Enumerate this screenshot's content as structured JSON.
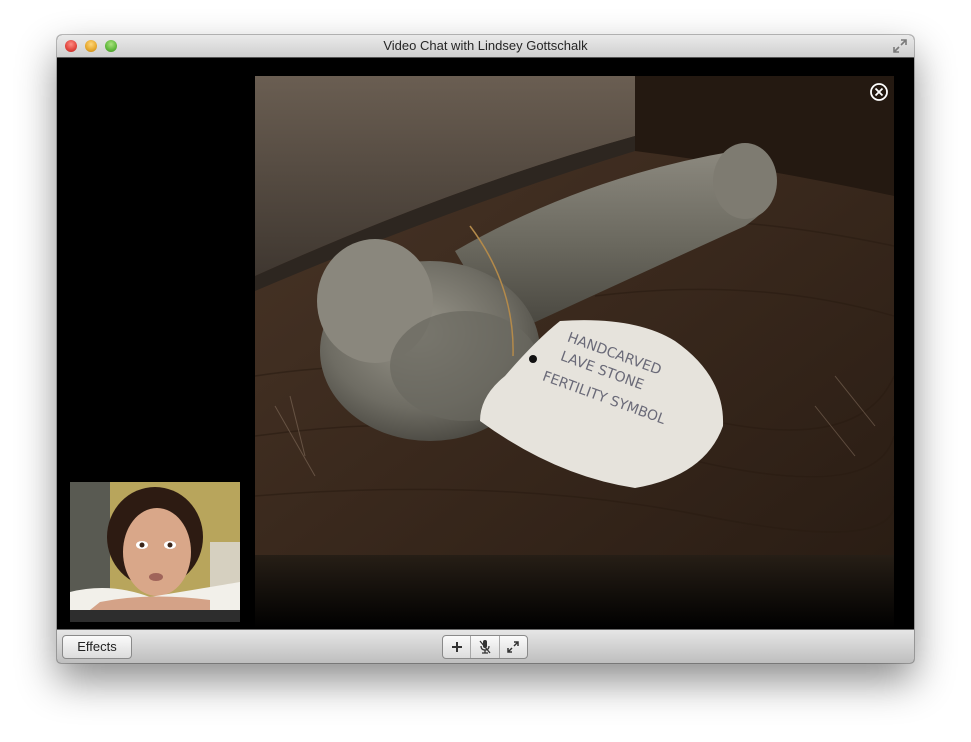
{
  "window": {
    "title": "Video Chat with Lindsey Gottschalk"
  },
  "remote_video": {
    "note_lines": [
      "HANDCARVED",
      "LAVE STONE",
      "FERTILITY SYMBOL"
    ]
  },
  "toolbar": {
    "effects_label": "Effects"
  },
  "icons": {
    "close": "close-circle-icon",
    "fullscreen": "fullscreen-icon",
    "add": "add-participant-icon",
    "mute": "microphone-mute-icon",
    "expand": "expand-icon"
  },
  "colors": {
    "titlebar": "#d6d6d6",
    "video_bg": "#000000",
    "wood": "#3a2a1e",
    "stone": "#75736a"
  }
}
